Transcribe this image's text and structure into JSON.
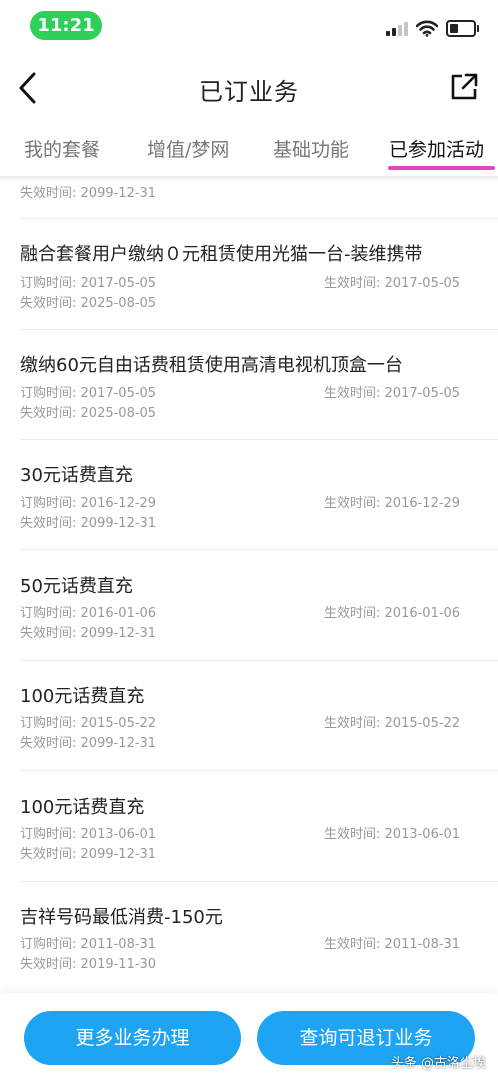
{
  "status_bar": {
    "time": "11:21"
  },
  "nav": {
    "title": "已订业务"
  },
  "tabs": [
    {
      "label": "我的套餐",
      "active": false
    },
    {
      "label": "增值/梦网",
      "active": false
    },
    {
      "label": "基础功能",
      "active": false
    },
    {
      "label": "已参加活动",
      "active": true
    }
  ],
  "labels": {
    "order": "订购时间:",
    "effective": "生效时间:",
    "expire": "失效时间:"
  },
  "clipped_expire": "2099-12-31",
  "items": [
    {
      "name": "融合套餐用户缴纳０元租赁使用光猫一台-装维携带",
      "order": "2017-05-05",
      "effective": "2017-05-05",
      "expire": "2025-08-05"
    },
    {
      "name": "缴纳60元自由话费租赁使用高清电视机顶盒一台",
      "order": "2017-05-05",
      "effective": "2017-05-05",
      "expire": "2025-08-05"
    },
    {
      "name": "30元话费直充",
      "order": "2016-12-29",
      "effective": "2016-12-29",
      "expire": "2099-12-31"
    },
    {
      "name": "50元话费直充",
      "order": "2016-01-06",
      "effective": "2016-01-06",
      "expire": "2099-12-31"
    },
    {
      "name": "100元话费直充",
      "order": "2015-05-22",
      "effective": "2015-05-22",
      "expire": "2099-12-31"
    },
    {
      "name": "100元话费直充",
      "order": "2013-06-01",
      "effective": "2013-06-01",
      "expire": "2099-12-31"
    },
    {
      "name": "吉祥号码最低消费-150元",
      "order": "2011-08-31",
      "effective": "2011-08-31",
      "expire": "2019-11-30"
    }
  ],
  "buttons": {
    "more": "更多业务办理",
    "query": "查询可退订业务"
  },
  "watermark": "头条 @古洛尘埃",
  "colors": {
    "accent": "#1fa4f3",
    "tab_indicator": "#e244c6",
    "time_pill": "#2fcf58"
  }
}
